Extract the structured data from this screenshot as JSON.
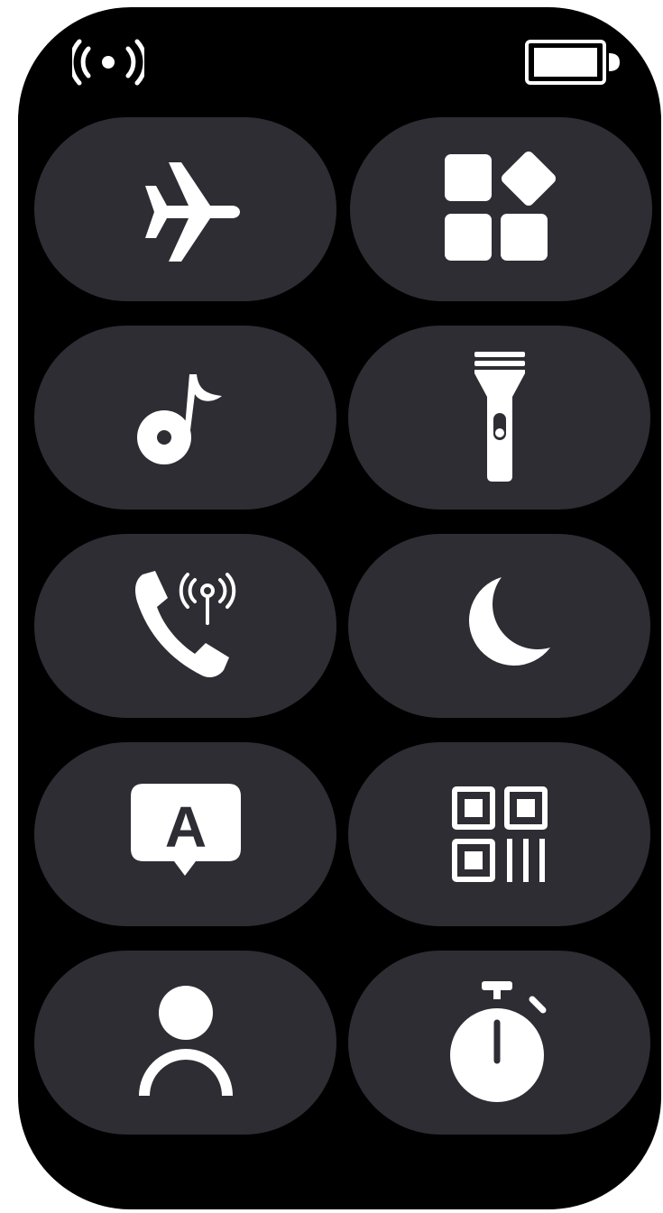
{
  "status_bar": {
    "left_icon": "connectivity-icon",
    "right_icon": "battery-icon",
    "battery_level_percent": 100
  },
  "control_center": {
    "colors": {
      "background": "#000000",
      "tile": "#2d2d33",
      "icon": "#ffffff"
    },
    "tiles": [
      {
        "icon": "airplane-icon"
      },
      {
        "icon": "apps-icon"
      },
      {
        "icon": "music-note-icon"
      },
      {
        "icon": "flashlight-icon"
      },
      {
        "icon": "phone-signal-icon"
      },
      {
        "icon": "moon-icon"
      },
      {
        "icon": "translate-icon"
      },
      {
        "icon": "qr-code-icon"
      },
      {
        "icon": "person-icon"
      },
      {
        "icon": "stopwatch-icon"
      }
    ]
  }
}
